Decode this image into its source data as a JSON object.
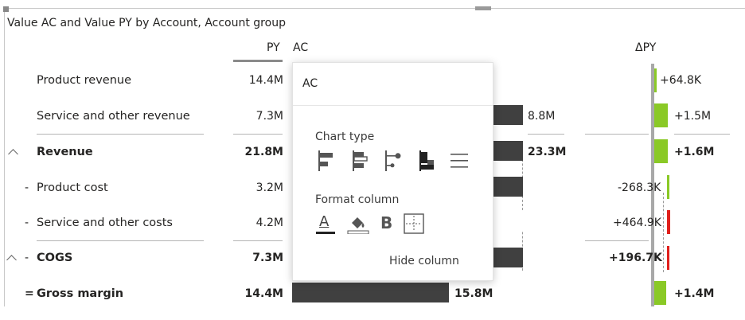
{
  "visual": {
    "title": "Value AC and Value PY by Account, Account group"
  },
  "columns": {
    "py": "PY",
    "ac": "AC",
    "delta_py": "ΔPY"
  },
  "rows": [
    {
      "label": "Product revenue",
      "prefix": "",
      "py": "14.4M",
      "ac": "",
      "delta": "+64.8K",
      "bold": false,
      "delta_color": "#8ac926"
    },
    {
      "label": "Service and other revenue",
      "prefix": "",
      "py": "7.3M",
      "ac": "8.8M",
      "delta": "+1.5M",
      "bold": false,
      "delta_color": "#8ac926"
    },
    {
      "label": "Revenue",
      "prefix": "",
      "py": "21.8M",
      "ac": "23.3M",
      "delta": "+1.6M",
      "bold": true,
      "delta_color": "#8ac926"
    },
    {
      "label": "Product cost",
      "prefix": "-",
      "py": "3.2M",
      "ac": "",
      "delta": "-268.3K",
      "bold": false,
      "delta_color": "#8ac926"
    },
    {
      "label": "Service and other costs",
      "prefix": "-",
      "py": "4.2M",
      "ac": "",
      "delta": "+464.9K",
      "bold": false,
      "delta_color": "#e0201c"
    },
    {
      "label": "COGS",
      "prefix": "-",
      "py": "7.3M",
      "ac": "",
      "delta": "+196.7K",
      "bold": true,
      "delta_color": "#e0201c"
    },
    {
      "label": "Gross margin",
      "prefix": "=",
      "py": "14.4M",
      "ac": "15.8M",
      "delta": "+1.4M",
      "bold": true,
      "delta_color": "#8ac926"
    }
  ],
  "popup": {
    "title": "AC",
    "chart_type_label": "Chart type",
    "chart_type_icons": [
      "bar-chart-icon",
      "bar-overlap-icon",
      "pin-chart-icon",
      "waterfall-chart-icon",
      "hidden-lines-icon"
    ],
    "format_column_label": "Format column",
    "format_icons": [
      "font-color-icon",
      "fill-color-icon",
      "bold-icon",
      "border-icon"
    ],
    "format_bold_glyph": "B",
    "font_color_glyph": "A",
    "hide_column_label": "Hide column"
  }
}
